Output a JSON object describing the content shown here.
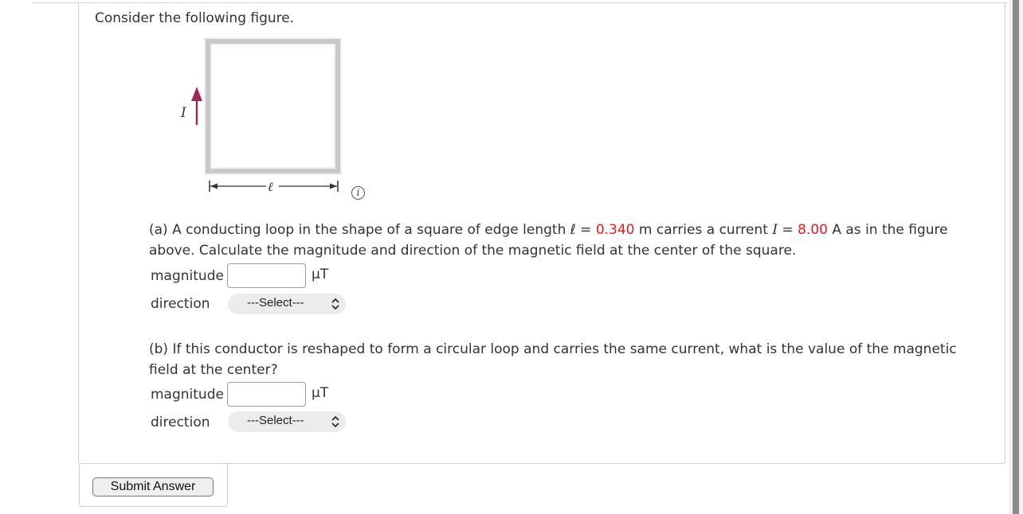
{
  "prompt": "Consider the following figure.",
  "figure": {
    "current_label": "I",
    "edge_label": "ℓ",
    "arrow_color": "#9b2a5a",
    "info_icon": "i"
  },
  "part_a": {
    "text1": "(a) A conducting loop in the shape of a square of edge length ℓ = ",
    "edge_value": "0.340",
    "text2": " m carries a current ",
    "current_symbol": "I",
    "text3": " = ",
    "current_value": "8.00",
    "text4": " A as in the figure above. Calculate the magnitude and direction of the magnetic field at the center of the square.",
    "magnitude_label": "magnitude",
    "magnitude_value": "",
    "unit": "μT",
    "direction_label": "direction",
    "direction_selected": "---Select---"
  },
  "part_b": {
    "text": "(b) If this conductor is reshaped to form a circular loop and carries the same current, what is the value of the magnetic field at the center?",
    "magnitude_label": "magnitude",
    "magnitude_value": "",
    "unit": "μT",
    "direction_label": "direction",
    "direction_selected": "---Select---"
  },
  "submit_label": "Submit Answer",
  "colors": {
    "given_value": "#e01b1b",
    "border": "#cfcfcf"
  }
}
